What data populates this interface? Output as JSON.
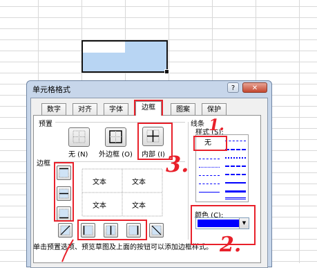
{
  "dialog": {
    "title": "单元格格式",
    "help_label": "?",
    "close_label": "✕",
    "tabs": [
      "数字",
      "对齐",
      "字体",
      "边框",
      "图案",
      "保护"
    ],
    "active_tab": "边框"
  },
  "presets": {
    "section_label": "预置",
    "items": [
      {
        "label": "无 (N)",
        "icon": "border-none-icon"
      },
      {
        "label": "外边框 (O)",
        "icon": "border-outline-icon"
      },
      {
        "label": "内部 (I)",
        "icon": "border-inside-icon"
      }
    ]
  },
  "border": {
    "section_label": "边框",
    "preview_cells": [
      "文本",
      "文本",
      "文本",
      "文本"
    ],
    "left_buttons": [
      "border-top-icon",
      "border-middle-horizontal-icon",
      "border-bottom-icon"
    ],
    "bottom_buttons": [
      "border-diagonal-up-icon",
      "border-left-icon",
      "border-middle-vertical-icon",
      "border-right-icon",
      "border-diagonal-down-icon"
    ]
  },
  "line": {
    "section_label": "线条",
    "style_label": "样式 (S):",
    "none_label": "无",
    "color_label": "颜色 (C):",
    "color_value": "#0000ff"
  },
  "footer_text": "单击预置选项、预览草图及上面的按钮可以添加边框样式。",
  "annotations": {
    "step1": "1.",
    "step2": "2.",
    "step3": "3."
  },
  "colors": {
    "annotation": "#e8202a",
    "selection_fill": "#b8d5f3"
  }
}
